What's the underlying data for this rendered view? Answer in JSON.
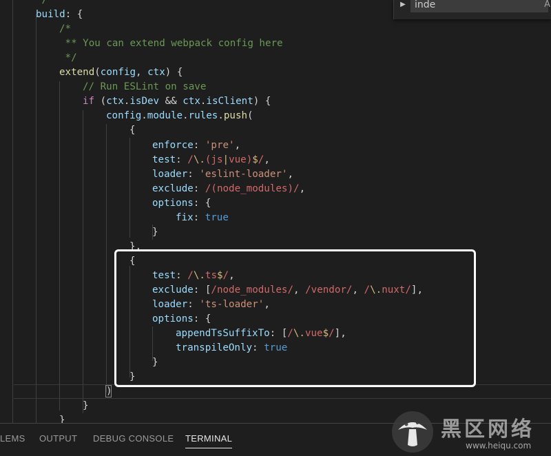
{
  "editor": {
    "lines": [
      [
        [
          "*/",
          "comment"
        ]
      ],
      [
        [
          "build",
          "key"
        ],
        [
          ": {",
          "punc"
        ]
      ],
      [
        [
          "/*",
          "comment"
        ]
      ],
      [
        [
          " ** You can extend webpack config here",
          "comment"
        ]
      ],
      [
        [
          " */",
          "comment"
        ]
      ],
      [
        [
          "extend",
          "func"
        ],
        [
          "(",
          "punc"
        ],
        [
          "config",
          "var"
        ],
        [
          ", ",
          "punc"
        ],
        [
          "ctx",
          "var"
        ],
        [
          ") {",
          "punc"
        ]
      ],
      [
        [
          "// Run ESLint on save",
          "comment"
        ]
      ],
      [
        [
          "if",
          "kw"
        ],
        [
          " (",
          "punc"
        ],
        [
          "ctx",
          "var"
        ],
        [
          ".",
          "punc"
        ],
        [
          "isDev",
          "var"
        ],
        [
          " && ",
          "punc"
        ],
        [
          "ctx",
          "var"
        ],
        [
          ".",
          "punc"
        ],
        [
          "isClient",
          "var"
        ],
        [
          ") {",
          "punc"
        ]
      ],
      [
        [
          "config",
          "var"
        ],
        [
          ".",
          "punc"
        ],
        [
          "module",
          "var"
        ],
        [
          ".",
          "punc"
        ],
        [
          "rules",
          "var"
        ],
        [
          ".",
          "punc"
        ],
        [
          "push",
          "func"
        ],
        [
          "(",
          "punc"
        ]
      ],
      [
        [
          "{",
          "punc"
        ]
      ],
      [
        [
          "enforce",
          "key"
        ],
        [
          ": ",
          "punc"
        ],
        [
          "'pre'",
          "str"
        ],
        [
          ",",
          "punc"
        ]
      ],
      [
        [
          "test",
          "key"
        ],
        [
          ": ",
          "punc"
        ],
        [
          "/",
          "re"
        ],
        [
          "\\.",
          "reEsc"
        ],
        [
          "(js",
          "re"
        ],
        [
          "|",
          "reEsc"
        ],
        [
          "vue)",
          "re"
        ],
        [
          "$",
          "reEsc"
        ],
        [
          "/",
          "re"
        ],
        [
          ",",
          "punc"
        ]
      ],
      [
        [
          "loader",
          "key"
        ],
        [
          ": ",
          "punc"
        ],
        [
          "'eslint-loader'",
          "str"
        ],
        [
          ",",
          "punc"
        ]
      ],
      [
        [
          "exclude",
          "key"
        ],
        [
          ": ",
          "punc"
        ],
        [
          "/(node_modules)/",
          "re"
        ],
        [
          ",",
          "punc"
        ]
      ],
      [
        [
          "options",
          "key"
        ],
        [
          ": {",
          "punc"
        ]
      ],
      [
        [
          "fix",
          "key"
        ],
        [
          ": ",
          "punc"
        ],
        [
          "true",
          "bool"
        ]
      ],
      [
        [
          "}",
          "punc"
        ]
      ],
      [
        [
          "},",
          "punc"
        ]
      ],
      [
        [
          "{",
          "punc"
        ]
      ],
      [
        [
          "test",
          "key"
        ],
        [
          ": ",
          "punc"
        ],
        [
          "/",
          "re"
        ],
        [
          "\\.",
          "reEsc"
        ],
        [
          "ts",
          "re"
        ],
        [
          "$",
          "reEsc"
        ],
        [
          "/",
          "re"
        ],
        [
          ",",
          "punc"
        ]
      ],
      [
        [
          "exclude",
          "key"
        ],
        [
          ": [",
          "punc"
        ],
        [
          "/node_modules/",
          "re"
        ],
        [
          ", ",
          "punc"
        ],
        [
          "/vendor/",
          "re"
        ],
        [
          ", ",
          "punc"
        ],
        [
          "/",
          "re"
        ],
        [
          "\\.",
          "reEsc"
        ],
        [
          "nuxt/",
          "re"
        ],
        [
          "],",
          "punc"
        ]
      ],
      [
        [
          "loader",
          "key"
        ],
        [
          ": ",
          "punc"
        ],
        [
          "'ts-loader'",
          "str"
        ],
        [
          ",",
          "punc"
        ]
      ],
      [
        [
          "options",
          "key"
        ],
        [
          ": {",
          "punc"
        ]
      ],
      [
        [
          "appendTsSuffixTo",
          "key"
        ],
        [
          ": [",
          "punc"
        ],
        [
          "/",
          "re"
        ],
        [
          "\\.",
          "reEsc"
        ],
        [
          "vue",
          "re"
        ],
        [
          "$",
          "reEsc"
        ],
        [
          "/",
          "re"
        ],
        [
          "],",
          "punc"
        ]
      ],
      [
        [
          "transpileOnly",
          "key"
        ],
        [
          ": ",
          "punc"
        ],
        [
          "true",
          "bool"
        ]
      ],
      [
        [
          "}",
          "punc"
        ]
      ],
      [
        [
          "}",
          "punc"
        ]
      ],
      [
        [
          ")",
          "punc"
        ]
      ],
      [
        [
          "}",
          "punc"
        ]
      ],
      [
        [
          "}",
          "punc"
        ]
      ]
    ]
  },
  "find": {
    "toggle_icon": "chevron-right-icon",
    "query": "inde",
    "match_case_label": "A"
  },
  "panel": {
    "tabs": [
      {
        "label": "LEMS",
        "active": false
      },
      {
        "label": "OUTPUT",
        "active": false
      },
      {
        "label": "DEBUG CONSOLE",
        "active": false
      },
      {
        "label": "TERMINAL",
        "active": true
      }
    ]
  },
  "watermark": {
    "text_cn": "黑区网络",
    "url": "www.heiqu.com"
  }
}
